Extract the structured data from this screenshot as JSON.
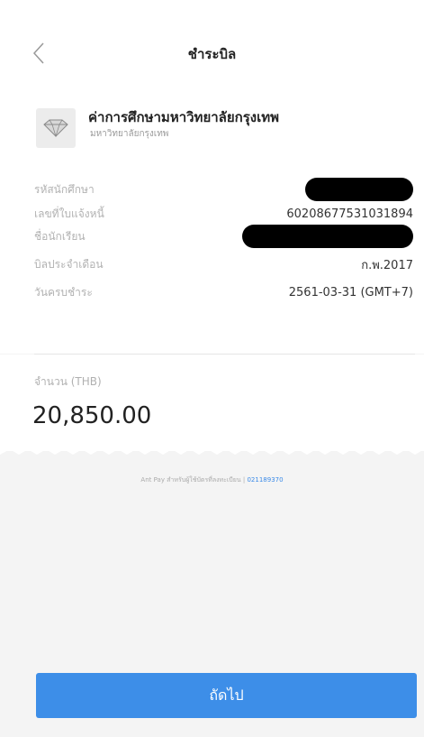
{
  "header": {
    "title": "ชำระบิล",
    "back_icon": "chevron-left-icon"
  },
  "merchant": {
    "name": "ค่าการศึกษามหาวิทยาลัยกรุงเทพ",
    "subtitle": "มหาวิทยาลัยกรุงเทพ",
    "logo_icon": "diamond-logo-icon"
  },
  "details": {
    "rows": [
      {
        "label": "รหัสนักศึกษา",
        "value": null,
        "redacted": true
      },
      {
        "label": "เลขที่ใบแจ้งหนี้",
        "value": "60208677531031894",
        "redacted": false
      },
      {
        "label": "ชื่อนักเรียน",
        "value": null,
        "redacted": true
      },
      {
        "label": "บิลประจำเดือน",
        "value": "ก.พ.2017",
        "redacted": false
      },
      {
        "label": "วันครบชำระ",
        "value": "2561-03-31 (GMT+7)",
        "redacted": false
      }
    ]
  },
  "amount": {
    "label": "จำนวน (THB)",
    "value": "20,850.00"
  },
  "reference": {
    "text": "Ant Pay สำหรับผู้ใช้บัตรที่ลงทะเบียน |",
    "id": "021189370"
  },
  "footer": {
    "next_label": "ถัดไป"
  },
  "colors": {
    "accent": "#3d8ee8",
    "label_gray": "#b2b2b2",
    "background": "#f4f4f4"
  }
}
